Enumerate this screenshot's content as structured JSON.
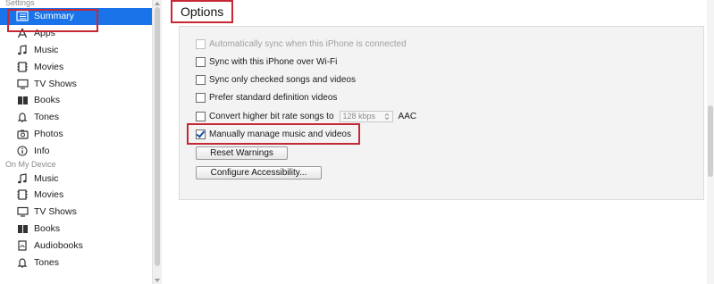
{
  "sidebar": {
    "settings_header": "Settings",
    "settings_items": [
      {
        "label": "Summary",
        "icon": "summary-icon",
        "selected": true
      },
      {
        "label": "Apps",
        "icon": "apps-icon"
      },
      {
        "label": "Music",
        "icon": "music-note-icon"
      },
      {
        "label": "Movies",
        "icon": "film-icon"
      },
      {
        "label": "TV Shows",
        "icon": "tv-icon"
      },
      {
        "label": "Books",
        "icon": "book-icon"
      },
      {
        "label": "Tones",
        "icon": "bell-icon"
      },
      {
        "label": "Photos",
        "icon": "camera-icon"
      },
      {
        "label": "Info",
        "icon": "info-icon"
      }
    ],
    "device_header": "On My Device",
    "device_items": [
      {
        "label": "Music",
        "icon": "music-note-icon"
      },
      {
        "label": "Movies",
        "icon": "film-icon"
      },
      {
        "label": "TV Shows",
        "icon": "tv-icon"
      },
      {
        "label": "Books",
        "icon": "book-icon"
      },
      {
        "label": "Audiobooks",
        "icon": "audiobook-icon"
      },
      {
        "label": "Tones",
        "icon": "bell-icon"
      }
    ]
  },
  "options": {
    "title": "Options",
    "rows": [
      {
        "label": "Automatically sync when this iPhone is connected",
        "checked": false,
        "disabled": true
      },
      {
        "label": "Sync with this iPhone over Wi-Fi",
        "checked": false,
        "disabled": false
      },
      {
        "label": "Sync only checked songs and videos",
        "checked": false,
        "disabled": false
      },
      {
        "label": "Prefer standard definition videos",
        "checked": false,
        "disabled": false
      },
      {
        "label": "Convert higher bit rate songs to",
        "checked": false,
        "disabled": false
      },
      {
        "label": "Manually manage music and videos",
        "checked": true,
        "disabled": false
      }
    ],
    "bitrate_value": "128 kbps",
    "bitrate_suffix": "AAC",
    "reset_warnings_label": "Reset Warnings",
    "configure_accessibility_label": "Configure Accessibility..."
  },
  "colors": {
    "selection": "#1a73e8",
    "highlight_box": "#c62836"
  }
}
